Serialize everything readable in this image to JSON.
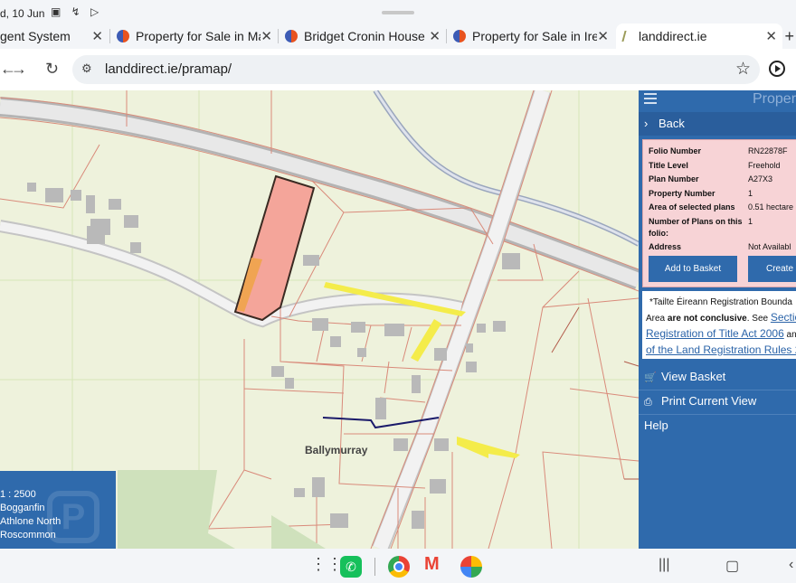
{
  "status_bar": {
    "time": "d, 10 Jun"
  },
  "tabs": [
    {
      "title": "gent System",
      "active": false
    },
    {
      "title": "Property for Sale in May",
      "active": false
    },
    {
      "title": "Bridget Cronin House M",
      "active": false
    },
    {
      "title": "Property for Sale in Irela",
      "active": false
    },
    {
      "title": "landdirect.ie",
      "active": true
    }
  ],
  "address_bar": {
    "url": "landdirect.ie/pramap/"
  },
  "map": {
    "place_label": "Ballymurray",
    "scale": "1 : 2500",
    "location_lines": [
      "Bogganfin",
      "Athlone North",
      "Roscommon"
    ],
    "watermark": "P"
  },
  "panel": {
    "title": "Proper",
    "back_label": "Back",
    "details": [
      {
        "label": "Folio Number",
        "value": "RN22878F"
      },
      {
        "label": "Title Level",
        "value": "Freehold"
      },
      {
        "label": "Plan Number",
        "value": "A27X3"
      },
      {
        "label": "Property Number",
        "value": "1"
      },
      {
        "label": "Area of selected plans",
        "value": "0.51 hectare"
      },
      {
        "label": "Number of Plans on this folio:",
        "value": "1"
      },
      {
        "label": "Address",
        "value": "Not Availabl"
      }
    ],
    "add_to_basket": "Add to Basket",
    "create": "Create",
    "notice": {
      "line1": "*Tailte Éireann Registration Bounda",
      "line2_pre": "Area ",
      "line2_bold": "are not conclusive",
      "line2_post": ". See ",
      "link1": "Sectio",
      "link2": "Registration of Title Act 2006",
      "link2_tail": " an",
      "link3": "of the Land Registration Rules 2"
    },
    "links": {
      "view_basket": "View Basket",
      "print_view": "Print Current View",
      "help": "Help"
    }
  }
}
